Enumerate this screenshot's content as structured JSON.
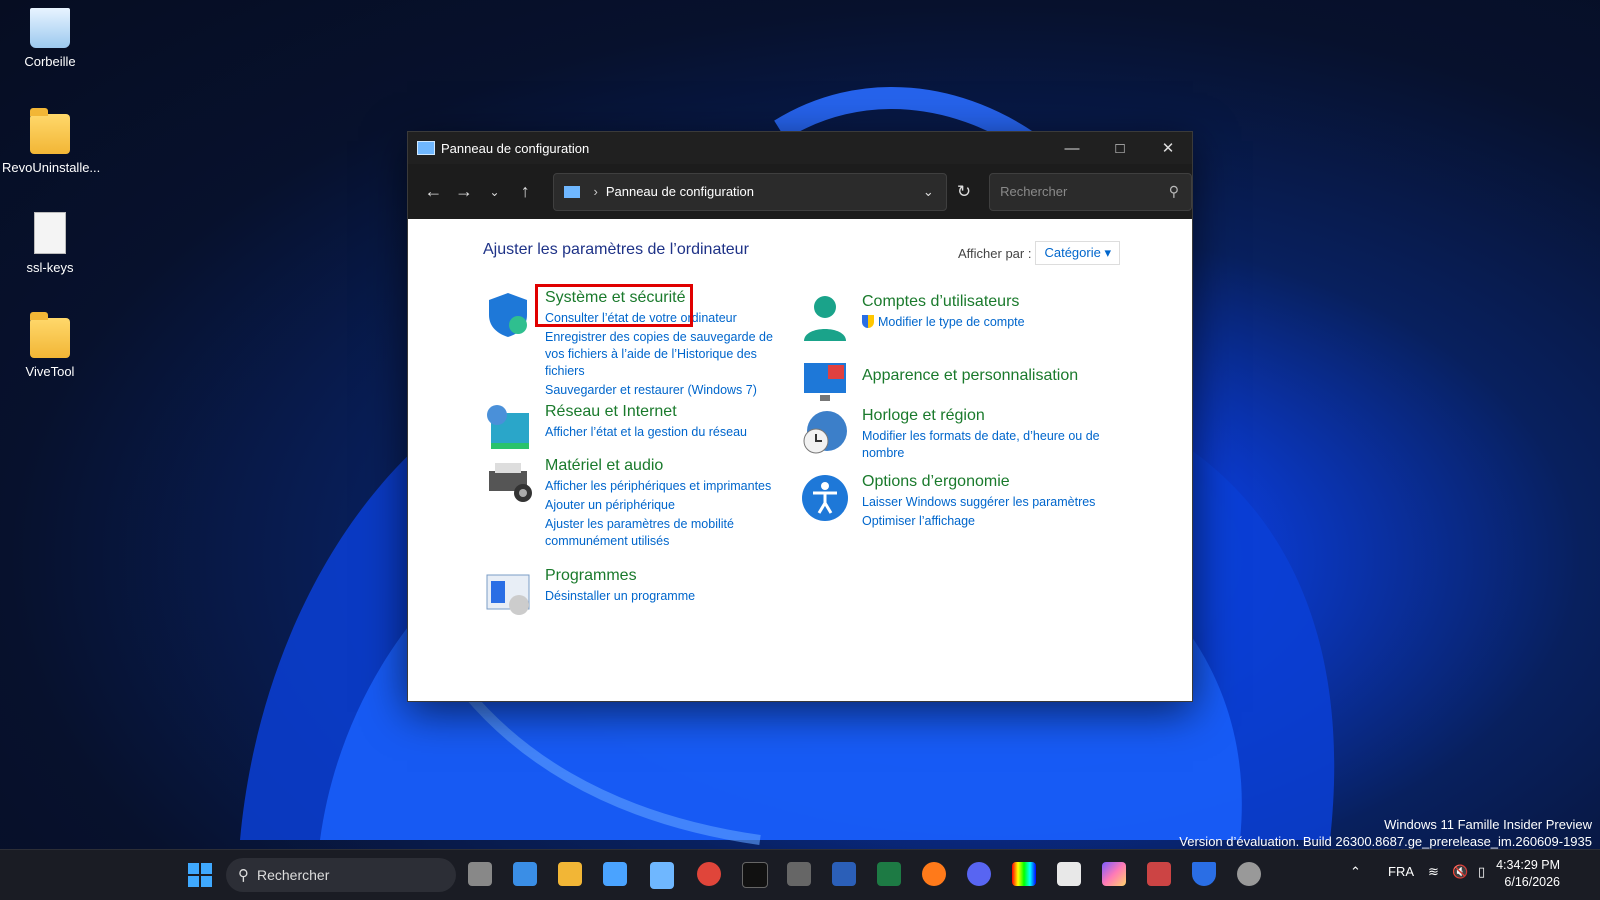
{
  "desktop": {
    "icons": [
      {
        "label": "Corbeille"
      },
      {
        "label": "RevoUninstalle..."
      },
      {
        "label": "ssl-keys"
      },
      {
        "label": "ViveTool"
      }
    ],
    "watermark": {
      "line1": "Windows 11 Famille Insider Preview",
      "line2": "Version d’évaluation. Build 26300.8687.ge_prerelease_im.260609-1935"
    }
  },
  "window": {
    "title": "Panneau de configuration",
    "address": "Panneau de configuration",
    "search_placeholder": "Rechercher",
    "heading": "Ajuster les paramètres de l’ordinateur",
    "view_by_label": "Afficher par :",
    "view_by_value": "Catégorie ▾",
    "categories_left": [
      {
        "title": "Système et sécurité",
        "links": [
          "Consulter l’état de votre ordinateur",
          "Enregistrer des copies de sauvegarde de vos fichiers à l’aide de l’Historique des fichiers",
          "Sauvegarder et restaurer (Windows 7)"
        ]
      },
      {
        "title": "Réseau et Internet",
        "links": [
          "Afficher l’état et la gestion du réseau"
        ]
      },
      {
        "title": "Matériel et audio",
        "links": [
          "Afficher les périphériques et imprimantes",
          "Ajouter un périphérique",
          "Ajuster les paramètres de mobilité communément utilisés"
        ]
      },
      {
        "title": "Programmes",
        "links": [
          "Désinstaller un programme"
        ]
      }
    ],
    "categories_right": [
      {
        "title": "Comptes d’utilisateurs",
        "links": [
          "Modifier le type de compte"
        ]
      },
      {
        "title": "Apparence et personnalisation",
        "links": []
      },
      {
        "title": "Horloge et région",
        "links": [
          "Modifier les formats de date, d’heure ou de nombre"
        ]
      },
      {
        "title": "Options d’ergonomie",
        "links": [
          "Laisser Windows suggérer les paramètres",
          "Optimiser l’affichage"
        ]
      }
    ]
  },
  "taskbar": {
    "search_label": "Rechercher",
    "language": "FRA",
    "time": "4:34:29 PM",
    "date": "6/16/2026"
  }
}
